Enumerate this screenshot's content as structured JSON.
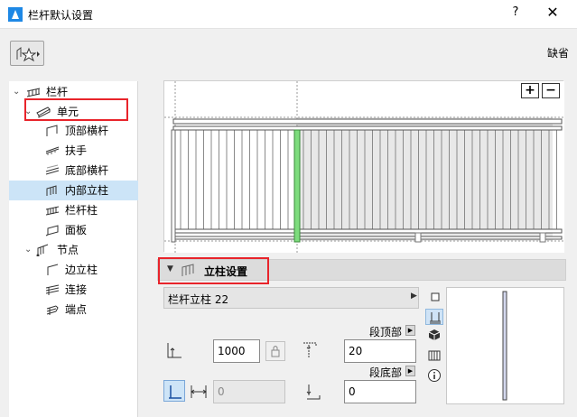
{
  "window": {
    "title": "栏杆默认设置",
    "help_label": "?",
    "close_label": "✕",
    "default_label": "缺省"
  },
  "tree": {
    "items": [
      {
        "label": "栏杆",
        "icon": "railing-icon"
      },
      {
        "label": "单元",
        "icon": "segment-icon"
      },
      {
        "label": "顶部横杆",
        "icon": "top-rail-icon"
      },
      {
        "label": "扶手",
        "icon": "handrail-icon"
      },
      {
        "label": "底部横杆",
        "icon": "bottom-rail-icon"
      },
      {
        "label": "内部立柱",
        "icon": "inner-post-icon"
      },
      {
        "label": "栏杆柱",
        "icon": "baluster-icon"
      },
      {
        "label": "面板",
        "icon": "panel-icon"
      },
      {
        "label": "节点",
        "icon": "node-icon"
      },
      {
        "label": "边立柱",
        "icon": "end-post-icon"
      },
      {
        "label": "连接",
        "icon": "connection-icon"
      },
      {
        "label": "端点",
        "icon": "endpoint-icon"
      }
    ],
    "selected": "内部立柱"
  },
  "preview": {
    "zoom_in": "+",
    "zoom_out": "−"
  },
  "section": {
    "title": "立柱设置"
  },
  "post": {
    "type_label": "栏杆立柱 22",
    "height_value": "1000",
    "segment_top_label": "段顶部",
    "top_offset_value": "20",
    "segment_bottom_label": "段底部",
    "bottom_offset_value": "0",
    "offset_value": "0"
  },
  "colors": {
    "selection_highlight": "#e8242b",
    "tree_selected_bg": "#cce4f7",
    "post_highlight": "#7ddc7d"
  }
}
